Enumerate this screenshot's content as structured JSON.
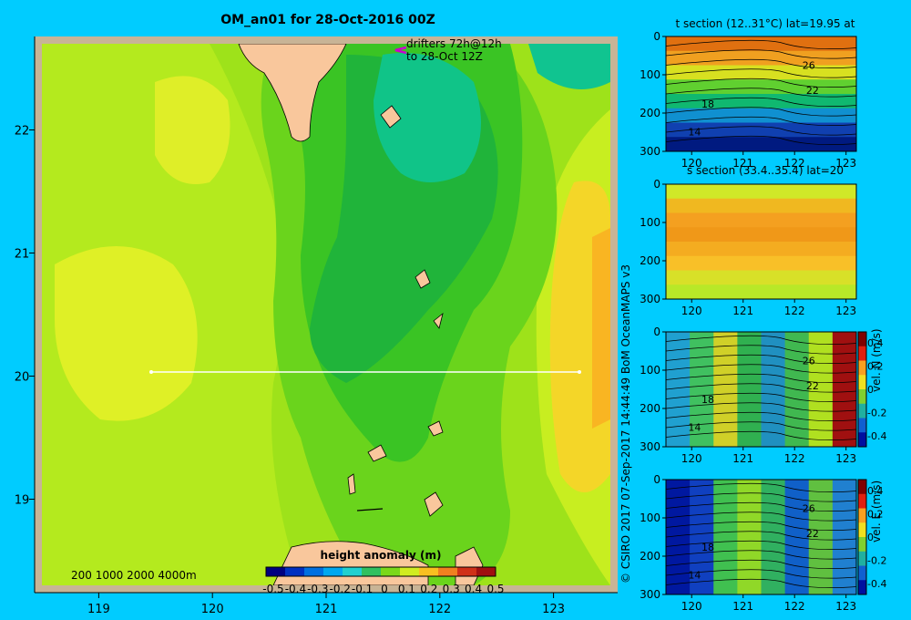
{
  "chart_data": [
    {
      "type": "heatmap",
      "title": "OM_an01 for 28-Oct-2016 00Z",
      "annotation": "drifters 72h@12h to 28-Oct 12Z",
      "annotation_lines": [
        "drifters 72h@12h",
        "to 28-Oct 12Z"
      ],
      "x_ticks": [
        "119",
        "120",
        "121",
        "122",
        "123"
      ],
      "x_tick_values": [
        119,
        120,
        121,
        122,
        123
      ],
      "y_ticks": [
        "22",
        "21",
        "20",
        "19"
      ],
      "y_tick_values": [
        22,
        21,
        20,
        19
      ],
      "xlim": [
        118.5,
        123.5
      ],
      "ylim": [
        18.3,
        22.7
      ],
      "depth_legend": "200 1000 2000 4000m",
      "colorbar": {
        "label": "height anomaly  (m)",
        "ticks": [
          "-0.5",
          "-0.4",
          "-0.3",
          "-0.2",
          "-0.1",
          "0",
          "0.1",
          "0.2",
          "0.3",
          "0.4",
          "0.5"
        ],
        "range": [
          -0.5,
          0.5
        ]
      },
      "section_line": {
        "lat": 20,
        "lon_start": 119.5,
        "lon_end": 123.2
      },
      "colors": {
        "land": "#f9c79c",
        "shelf": "#c8b496",
        "frame": "#c8b496",
        "section_line": "#ffffff",
        "drifter": "#cc00cc"
      }
    },
    {
      "type": "heatmap",
      "title": "t section (12..31°C) lat=19.95 at",
      "x_ticks": [
        "120",
        "121",
        "122",
        "123"
      ],
      "x_tick_values": [
        120,
        121,
        122,
        123
      ],
      "y_ticks": [
        "0",
        "100",
        "200",
        "300"
      ],
      "y_tick_values": [
        0,
        100,
        200,
        300
      ],
      "xlim": [
        119.5,
        123.2
      ],
      "ylim": [
        0,
        300
      ],
      "contour_labels": [
        "26",
        "22",
        "18",
        "14"
      ]
    },
    {
      "type": "heatmap",
      "title": "s section (33.4..35.4) lat=20",
      "x_ticks": [
        "120",
        "121",
        "122",
        "123"
      ],
      "x_tick_values": [
        120,
        121,
        122,
        123
      ],
      "y_ticks": [
        "0",
        "100",
        "200",
        "300"
      ],
      "y_tick_values": [
        0,
        100,
        200,
        300
      ],
      "xlim": [
        119.5,
        123.2
      ],
      "ylim": [
        0,
        300
      ]
    },
    {
      "type": "heatmap",
      "title": "",
      "x_ticks": [
        "120",
        "121",
        "122",
        "123"
      ],
      "x_tick_values": [
        120,
        121,
        122,
        123
      ],
      "y_ticks": [
        "0",
        "100",
        "200",
        "300"
      ],
      "y_tick_values": [
        0,
        100,
        200,
        300
      ],
      "xlim": [
        119.5,
        123.2
      ],
      "ylim": [
        0,
        300
      ],
      "contour_labels": [
        "26",
        "22",
        "18",
        "14"
      ],
      "colorbar": {
        "label": "vel. N (m/s)",
        "ticks": [
          "0.4",
          "0.2",
          "0",
          "-0.2",
          "-0.4"
        ],
        "range": [
          -0.4,
          0.4
        ]
      }
    },
    {
      "type": "heatmap",
      "title": "",
      "x_ticks": [
        "120",
        "121",
        "122",
        "123"
      ],
      "x_tick_values": [
        120,
        121,
        122,
        123
      ],
      "y_ticks": [
        "0",
        "100",
        "200",
        "300"
      ],
      "y_tick_values": [
        0,
        100,
        200,
        300
      ],
      "xlim": [
        119.5,
        123.2
      ],
      "ylim": [
        0,
        300
      ],
      "contour_labels": [
        "26",
        "22",
        "18",
        "14"
      ],
      "colorbar": {
        "label": "vel. E (m/s)",
        "ticks": [
          "0.4",
          "0.2",
          "0",
          "-0.2",
          "-0.4"
        ],
        "range": [
          -0.4,
          0.4
        ]
      }
    }
  ],
  "credit": "© CSIRO 2017   07-Sep-2017 14:44:49 BoM OceanMAPS v3"
}
